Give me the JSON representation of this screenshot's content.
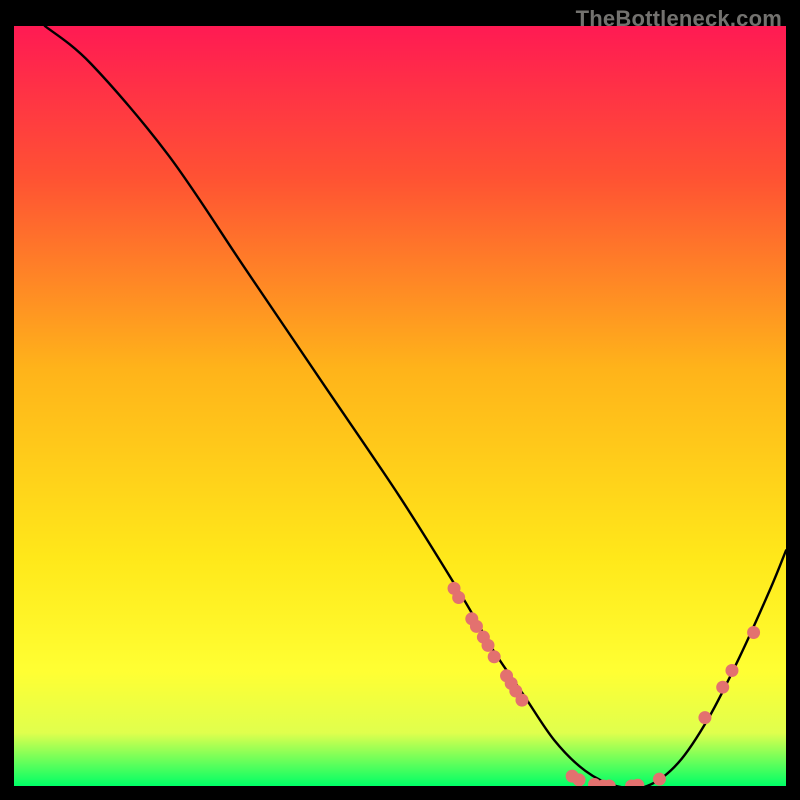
{
  "watermark": "TheBottleneck.com",
  "chart_data": {
    "type": "line",
    "title": "",
    "xlabel": "",
    "ylabel": "",
    "xlim": [
      0,
      100
    ],
    "ylim": [
      0,
      100
    ],
    "grid": false,
    "legend": false,
    "gradient_stops": [
      {
        "offset": 0.0,
        "color": "#ff1a53"
      },
      {
        "offset": 0.2,
        "color": "#ff5233"
      },
      {
        "offset": 0.45,
        "color": "#ffb31a"
      },
      {
        "offset": 0.7,
        "color": "#ffe81a"
      },
      {
        "offset": 0.85,
        "color": "#ffff33"
      },
      {
        "offset": 0.93,
        "color": "#e0ff4d"
      },
      {
        "offset": 1.0,
        "color": "#00ff66"
      }
    ],
    "series": [
      {
        "name": "bottleneck-curve",
        "x": [
          4,
          10,
          20,
          30,
          40,
          50,
          58,
          62,
          66,
          70,
          74,
          78,
          82,
          86,
          90,
          94,
          98,
          100
        ],
        "y": [
          100,
          95,
          83,
          68,
          53,
          38,
          25,
          18,
          12,
          6,
          2,
          0,
          0,
          3,
          9,
          17,
          26,
          31
        ]
      }
    ],
    "marker_groups": [
      {
        "name": "left-cluster",
        "color": "#e3716f",
        "radius": 6.5,
        "points": [
          {
            "x": 57.0,
            "y": 26.0
          },
          {
            "x": 57.6,
            "y": 24.8
          },
          {
            "x": 59.3,
            "y": 22.0
          },
          {
            "x": 59.9,
            "y": 21.0
          },
          {
            "x": 60.8,
            "y": 19.6
          },
          {
            "x": 61.4,
            "y": 18.5
          },
          {
            "x": 62.2,
            "y": 17.0
          },
          {
            "x": 63.8,
            "y": 14.5
          },
          {
            "x": 64.4,
            "y": 13.5
          },
          {
            "x": 65.0,
            "y": 12.5
          },
          {
            "x": 65.8,
            "y": 11.3
          }
        ]
      },
      {
        "name": "bottom-cluster",
        "color": "#e3716f",
        "radius": 6.5,
        "points": [
          {
            "x": 72.3,
            "y": 1.3
          },
          {
            "x": 73.2,
            "y": 0.8
          },
          {
            "x": 75.2,
            "y": 0.2
          },
          {
            "x": 76.3,
            "y": 0.0
          },
          {
            "x": 77.1,
            "y": 0.0
          },
          {
            "x": 80.0,
            "y": 0.0
          },
          {
            "x": 80.8,
            "y": 0.1
          },
          {
            "x": 83.6,
            "y": 0.9
          }
        ]
      },
      {
        "name": "right-cluster",
        "color": "#e3716f",
        "radius": 6.5,
        "points": [
          {
            "x": 89.5,
            "y": 9.0
          },
          {
            "x": 91.8,
            "y": 13.0
          },
          {
            "x": 93.0,
            "y": 15.2
          },
          {
            "x": 95.8,
            "y": 20.2
          }
        ]
      }
    ]
  }
}
